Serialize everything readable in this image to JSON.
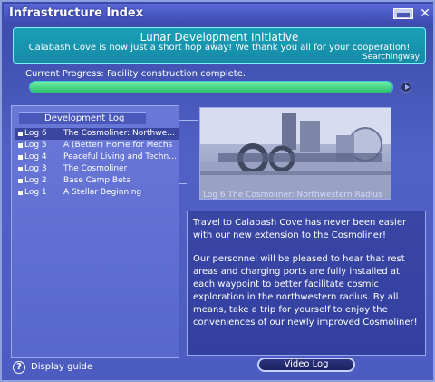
{
  "window": {
    "title": "Infrastructure Index"
  },
  "banner": {
    "title": "Lunar Development Initiative",
    "message": "Calabash Cove is now just a short hop away! We thank you all for your cooperation!",
    "author": "Searchingway"
  },
  "progress": {
    "label": "Current Progress: Facility construction complete.",
    "fraction": 1.0
  },
  "log_panel": {
    "header": "Development Log",
    "items": [
      {
        "num": "Log 6",
        "name": "The Cosmoliner: Northwestern...",
        "selected": true
      },
      {
        "num": "Log 5",
        "name": "A (Better) Home for Mechs",
        "selected": false
      },
      {
        "num": "Log 4",
        "name": "Peaceful Living and Technologic...",
        "selected": false
      },
      {
        "num": "Log 3",
        "name": "The Cosmoliner",
        "selected": false
      },
      {
        "num": "Log 2",
        "name": "Base Camp Beta",
        "selected": false
      },
      {
        "num": "Log 1",
        "name": "A Stellar Beginning",
        "selected": false
      }
    ]
  },
  "detail": {
    "caption": "Log 6 The Cosmoliner: Northwestern Radius",
    "paragraphs": [
      "Travel to Calabash Cove has never been easier with our new extension to the Cosmoliner!",
      "Our personnel will be pleased to hear that rest areas and charging ports are fully installed at each waypoint to better facilitate cosmic exploration in the northwestern radius. By all means, take a trip for yourself to enjoy the conveniences of our newly improved Cosmoliner!"
    ]
  },
  "footer": {
    "help": "?",
    "display_guide": "Display guide",
    "video_button": "Video Log"
  }
}
